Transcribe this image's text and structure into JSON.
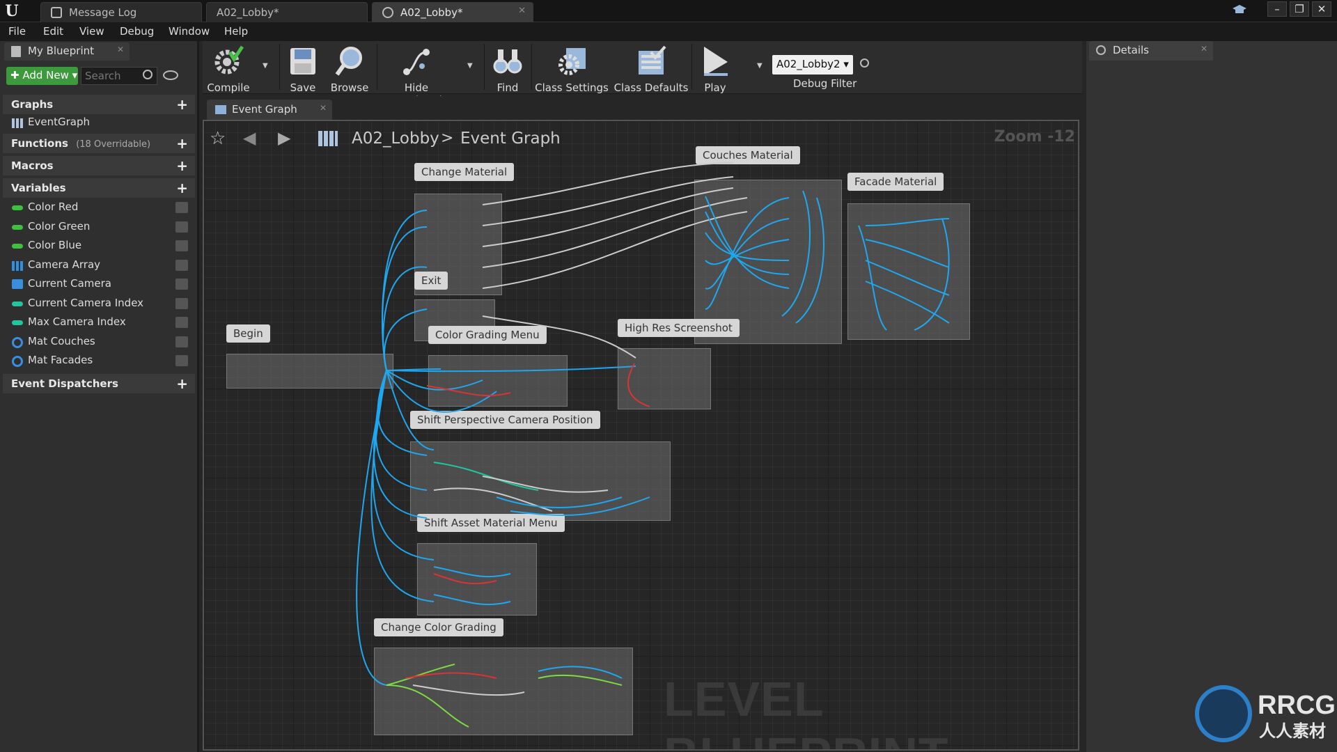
{
  "window": {
    "tabs": [
      {
        "label": "Message Log"
      },
      {
        "label": "A02_Lobby*"
      },
      {
        "label": "A02_Lobby*"
      }
    ]
  },
  "menu": [
    "File",
    "Edit",
    "View",
    "Debug",
    "Window",
    "Help"
  ],
  "my_blueprint": {
    "tab_label": "My Blueprint",
    "add_new_label": "Add New",
    "search_placeholder": "Search",
    "sections": {
      "graphs": "Graphs",
      "graph_item": "EventGraph",
      "functions": "Functions",
      "functions_sub": "(18 Overridable)",
      "macros": "Macros",
      "variables": "Variables",
      "event_dispatchers": "Event Dispatchers"
    },
    "variables": [
      {
        "name": "Color Red",
        "type": "pill",
        "color": "#3fc03f"
      },
      {
        "name": "Color Green",
        "type": "pill",
        "color": "#3fc03f"
      },
      {
        "name": "Color Blue",
        "type": "pill",
        "color": "#3fc03f"
      },
      {
        "name": "Camera Array",
        "type": "grid",
        "color": "#2f8fe0"
      },
      {
        "name": "Current Camera",
        "type": "cam",
        "color": "#3a8ee0"
      },
      {
        "name": "Current Camera Index",
        "type": "pill",
        "color": "#1fc7a0"
      },
      {
        "name": "Max Camera Index",
        "type": "pill",
        "color": "#1fc7a0"
      },
      {
        "name": "Mat Couches",
        "type": "ring",
        "color": "#3a8ee0"
      },
      {
        "name": "Mat Facades",
        "type": "ring",
        "color": "#3a8ee0"
      }
    ]
  },
  "toolbar": {
    "compile": "Compile",
    "save": "Save",
    "browse": "Browse",
    "hide_unrelated": "Hide Unrelated",
    "find": "Find",
    "class_settings": "Class Settings",
    "class_defaults": "Class Defaults",
    "play": "Play",
    "debug_select": "A02_Lobby2",
    "debug_filter": "Debug Filter"
  },
  "graph": {
    "tab_label": "Event Graph",
    "breadcrumb_root": "A02_Lobby",
    "breadcrumb_sep": ">",
    "breadcrumb_leaf": "Event Graph",
    "zoom": "Zoom -12",
    "watermark": "LEVEL BLUEPRINT",
    "comments": [
      {
        "label": "Change Material"
      },
      {
        "label": "Couches Material"
      },
      {
        "label": "Facade Material"
      },
      {
        "label": "Exit"
      },
      {
        "label": "Begin"
      },
      {
        "label": "Color Grading Menu"
      },
      {
        "label": "High Res Screenshot"
      },
      {
        "label": "Shift Perspective Camera Position"
      },
      {
        "label": "Shift Asset Material Menu"
      },
      {
        "label": "Change Color Grading"
      }
    ]
  },
  "details": {
    "tab_label": "Details"
  },
  "brand": {
    "logo_text": "RRCG",
    "logo_sub": "人人素材"
  },
  "colors": {
    "wire_exec": "#ffffff",
    "wire_blue": "#1fa7ef",
    "wire_red": "#d33",
    "wire_green": "#7cdc42",
    "wire_teal": "#1fc7a0"
  }
}
